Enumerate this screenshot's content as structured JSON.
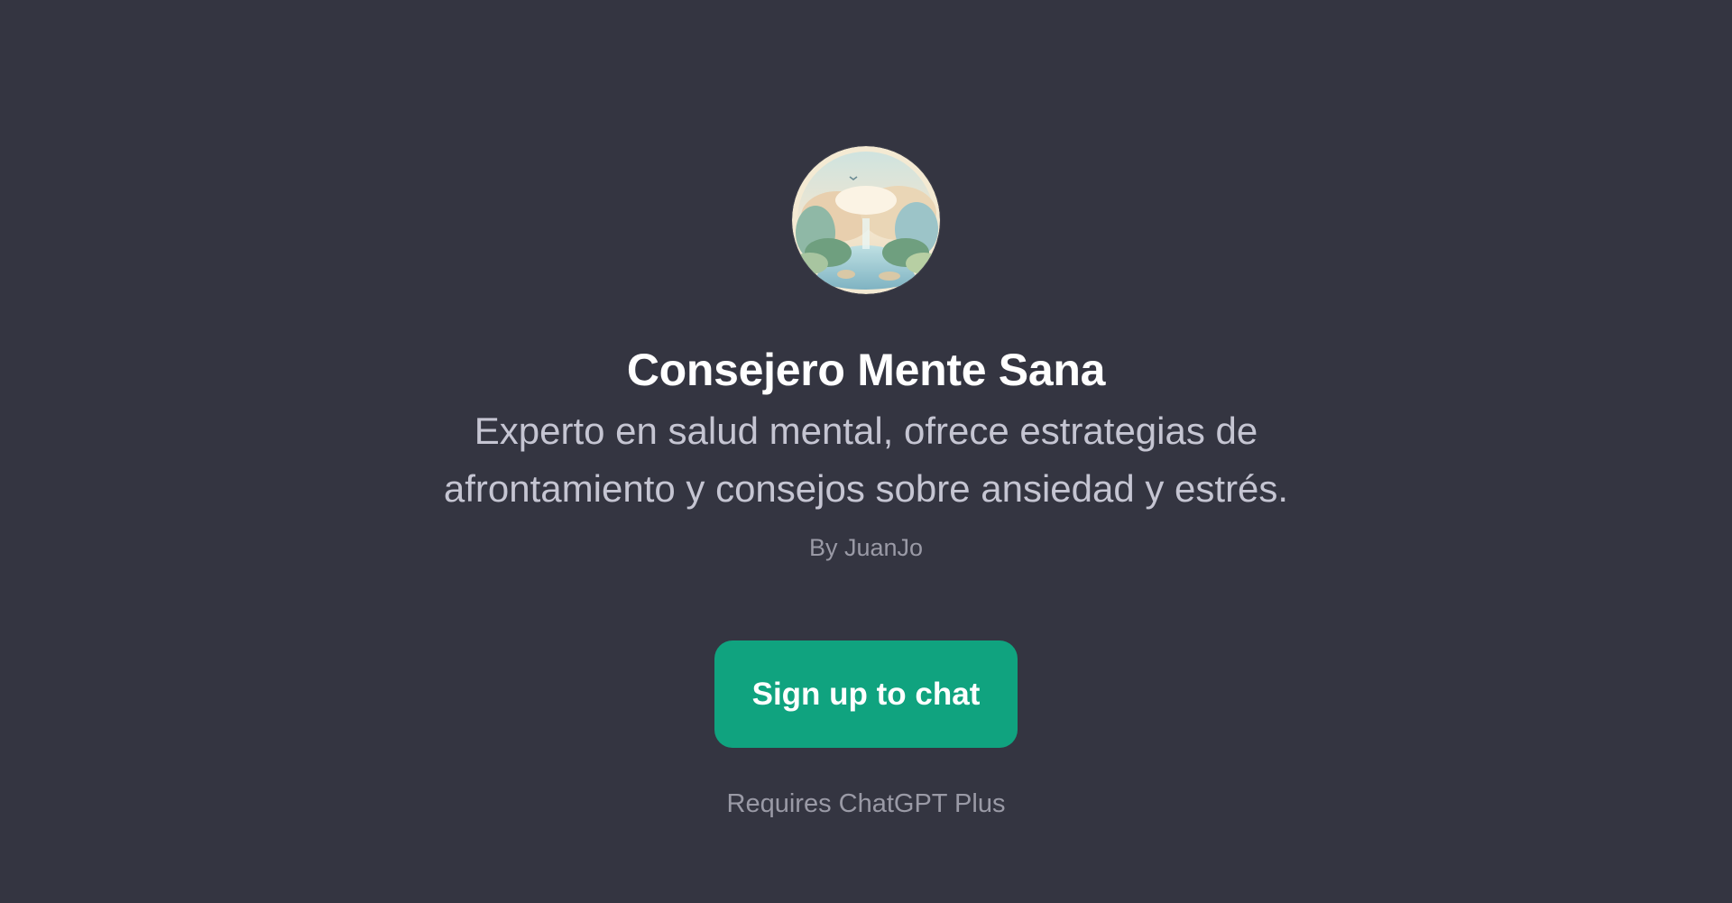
{
  "gpt": {
    "title": "Consejero Mente Sana",
    "description_lines": [
      "Experto en salud mental, ofrece estrategias de",
      "afrontamiento y consejos sobre ansiedad y estrés."
    ],
    "byline": "By JuanJo",
    "avatar_icon": "landscape-avatar-icon"
  },
  "actions": {
    "signup_label": "Sign up to chat",
    "requirement": "Requires ChatGPT Plus"
  },
  "colors": {
    "background": "#343541",
    "accent": "#10a37f"
  }
}
